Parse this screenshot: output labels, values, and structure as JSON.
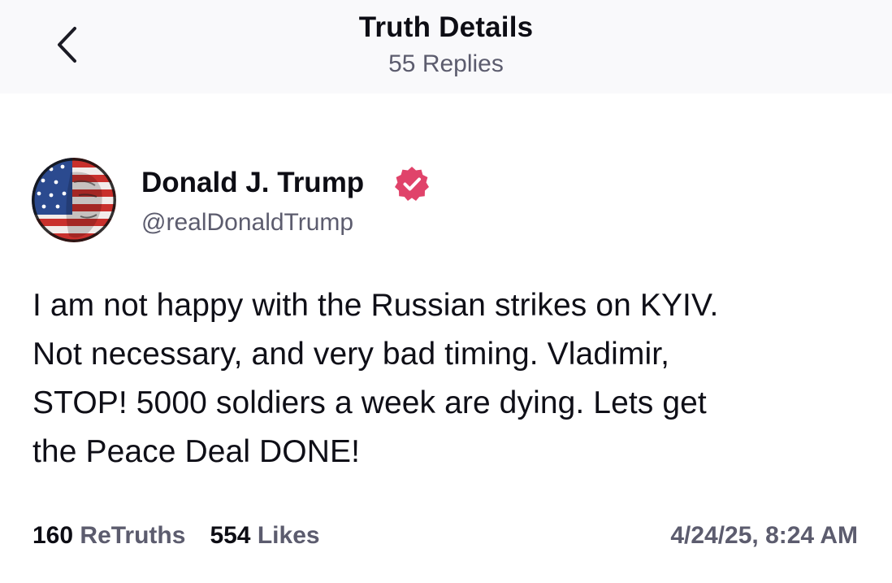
{
  "header": {
    "title": "Truth Details",
    "subtitle": "55 Replies",
    "back_icon": "chevron-left-icon"
  },
  "author": {
    "name": "Donald J. Trump",
    "handle": "@realDonaldTrump",
    "verified_icon": "verified-badge-icon",
    "verified_color": "#e0436a"
  },
  "post": {
    "lines": [
      "I am not happy with the Russian strikes on KYIV.",
      "Not necessary, and very bad timing. Vladimir,",
      "STOP! 5000 soldiers a week are dying. Lets get",
      "the Peace Deal DONE!"
    ]
  },
  "stats": {
    "retruths_count": "160",
    "retruths_label": "ReTruths",
    "likes_count": "554",
    "likes_label": "Likes"
  },
  "timestamp": "4/24/25, 8:24 AM",
  "colors": {
    "header_bg": "#f9f9fb",
    "text_primary": "#0d0d14",
    "text_secondary": "#5c5c6e"
  }
}
